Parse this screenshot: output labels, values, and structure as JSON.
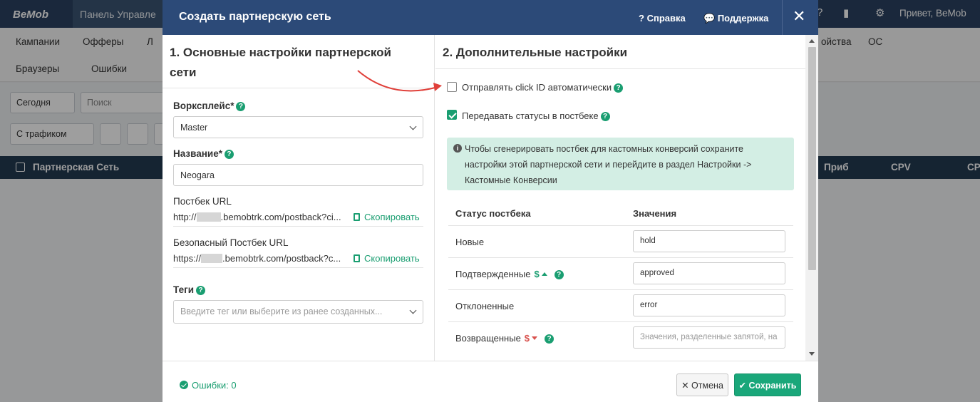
{
  "app": {
    "logo": "BeMob",
    "dashboard_tab": "Панель Управле",
    "greeting": "Привет, BeMob"
  },
  "nav": {
    "row1": [
      "Кампании",
      "Офферы",
      "Л",
      "ойства",
      "ОС"
    ],
    "row2": [
      "Браузеры",
      "Ошибки"
    ]
  },
  "filters": {
    "date": "Сегодня",
    "search_placeholder": "Поиск",
    "traffic": "С трафиком"
  },
  "table": {
    "headers": [
      "Партнерская Сеть",
      "Приб",
      "CPV",
      "CP"
    ]
  },
  "modal": {
    "title": "Создать партнерскую сеть",
    "help": "Справка",
    "support": "Поддержка",
    "close": "✕",
    "left": {
      "section_title": "1. Основные настройки партнерской сети",
      "workspace_label": "Ворксплейс*",
      "workspace_value": "Master",
      "name_label": "Название*",
      "name_value": "Neogara",
      "postback_label": "Постбек URL",
      "postback_prefix": "http://",
      "postback_suffix": ".bemobtrk.com/postback?ci...",
      "secure_postback_label": "Безопасный Постбек URL",
      "secure_postback_prefix": "https://",
      "secure_postback_suffix": ".bemobtrk.com/postback?c...",
      "copy_label": "Скопировать",
      "tags_label": "Теги",
      "tags_placeholder": "Введите тег или выберите из ранее созданных..."
    },
    "right": {
      "section_title": "2. Дополнительные настройки",
      "send_click_id": "Отправлять click ID автоматически",
      "send_click_id_checked": false,
      "pass_statuses": "Передавать статусы в постбеке",
      "pass_statuses_checked": true,
      "info_text": "Чтобы сгенерировать постбек для кастомных конверсий сохраните настройки этой партнерской сети и перейдите в раздел Настройки -> Кастомные Конверсии",
      "col_status": "Статус постбека",
      "col_values": "Значения",
      "rows": [
        {
          "status": "Новые",
          "value": "hold",
          "placeholder": ""
        },
        {
          "status": "Подтвержденные",
          "value": "approved",
          "placeholder": ""
        },
        {
          "status": "Отклоненные",
          "value": "error",
          "placeholder": ""
        },
        {
          "status": "Возвращенные",
          "value": "",
          "placeholder": "Значения, разделенные запятой, на"
        }
      ],
      "dollar_sign": "$"
    },
    "footer": {
      "errors": "Ошибки: 0",
      "cancel": "Отмена",
      "save": "Сохранить"
    }
  },
  "colors": {
    "modal_header": "#2c4a78",
    "accent_green": "#1a9e71",
    "info_bg": "#d3eee4",
    "arrow_red": "#e0403a"
  }
}
